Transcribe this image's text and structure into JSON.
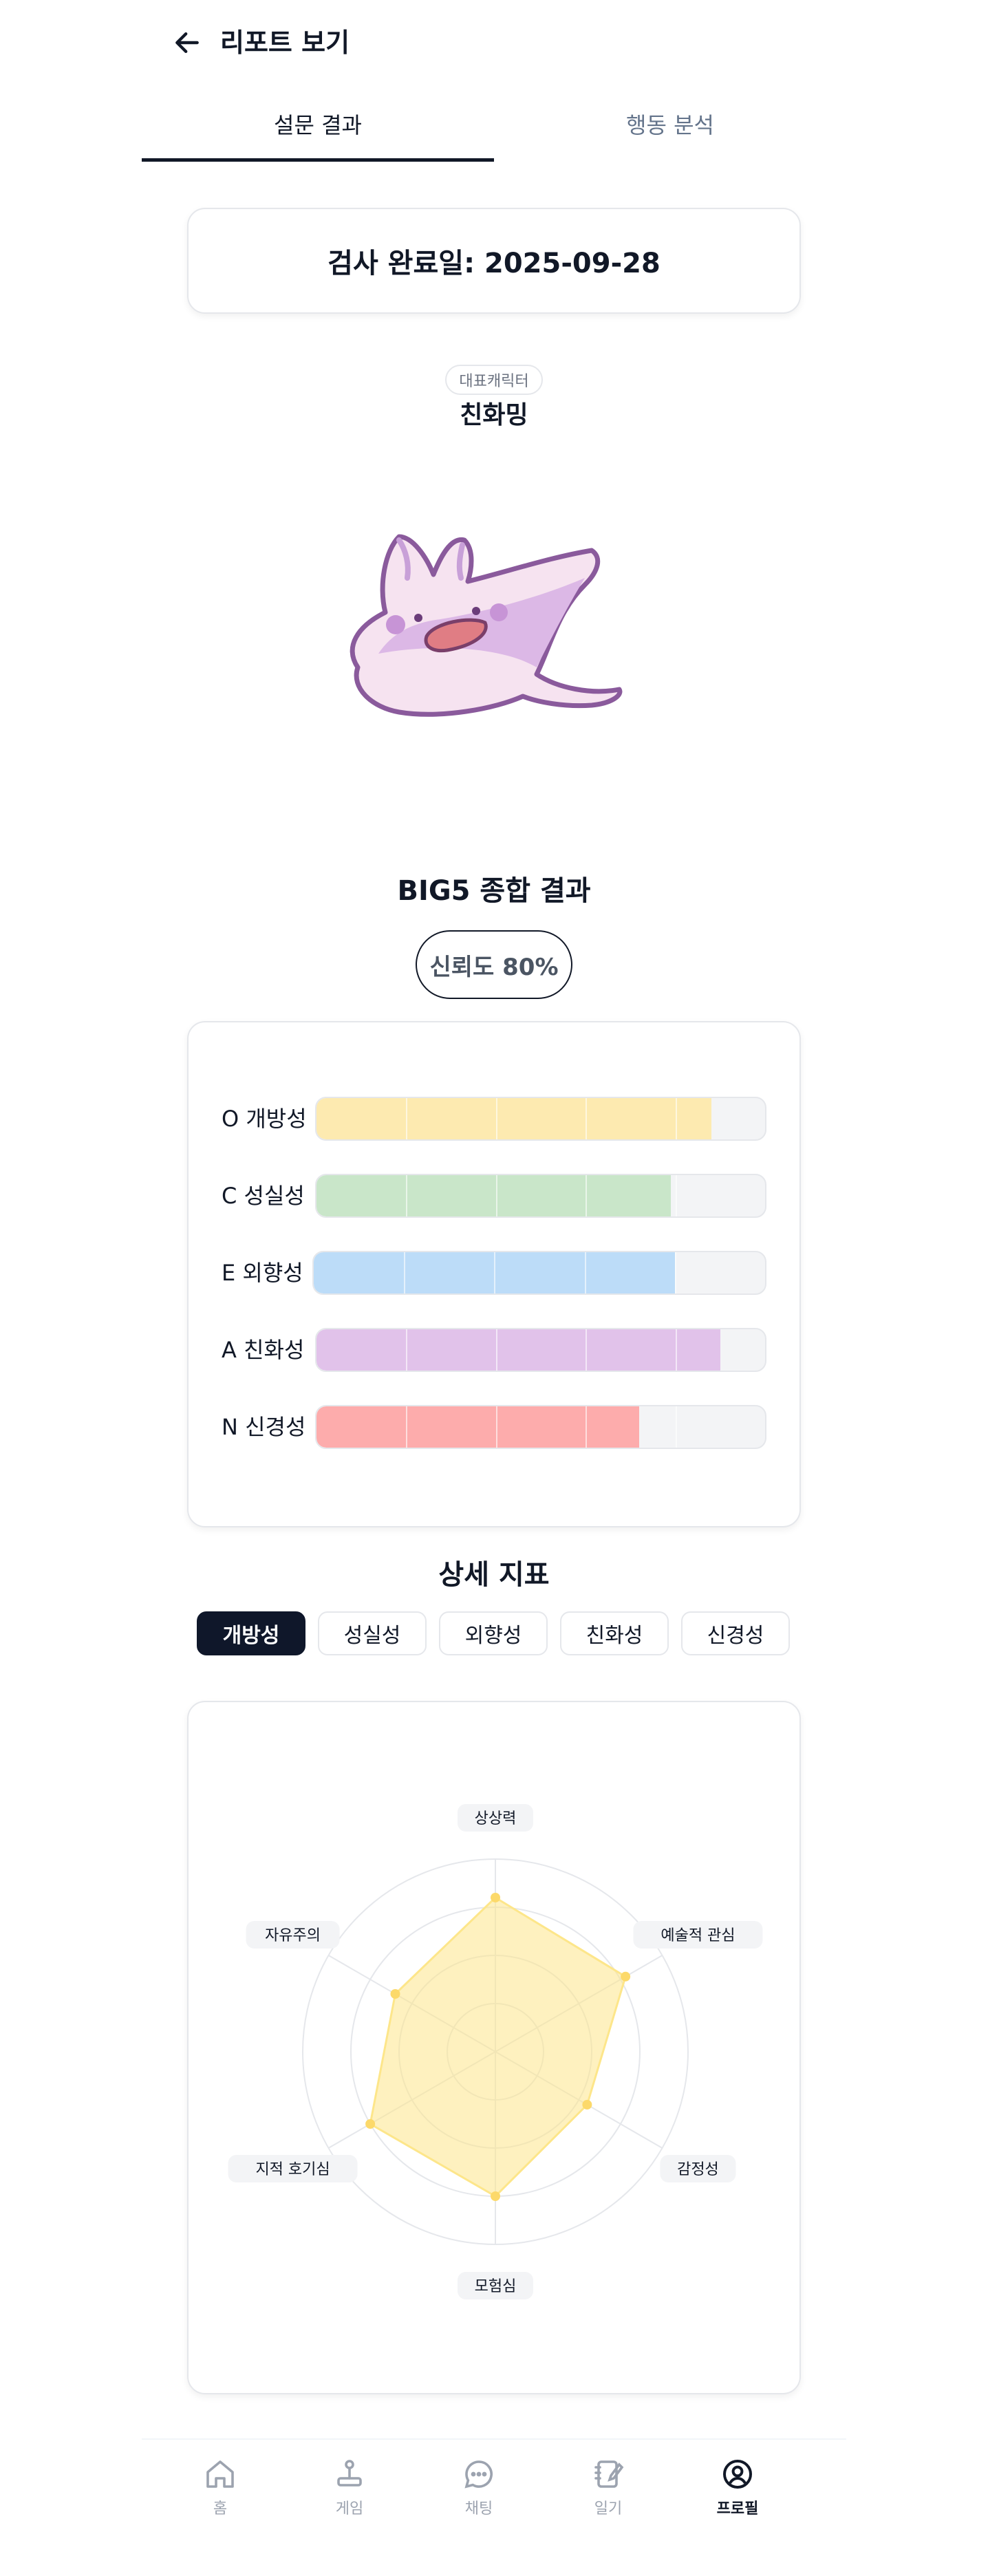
{
  "header": {
    "title": "리포트 보기",
    "back_icon": "arrow-left-icon"
  },
  "tabs": [
    {
      "label": "설문 결과",
      "active": true
    },
    {
      "label": "행동 분석",
      "active": false
    }
  ],
  "date_card": {
    "text": "검사 완료일: 2025-09-28"
  },
  "character": {
    "badge": "대표캐릭터",
    "name": "친화밍"
  },
  "big5": {
    "title": "BIG5 종합 결과",
    "reliability": "신뢰도 80%",
    "traits": [
      {
        "label": "O 개방성",
        "value": 88,
        "color": "#fdeab0"
      },
      {
        "label": "C 성실성",
        "value": 79,
        "color": "#c9e6c9"
      },
      {
        "label": "E 외향성",
        "value": 80,
        "color": "#bcdcf8"
      },
      {
        "label": "A 친화성",
        "value": 90,
        "color": "#e1c2ea"
      },
      {
        "label": "N 신경성",
        "value": 72,
        "color": "#fdacac"
      }
    ]
  },
  "detail": {
    "title": "상세 지표",
    "chips": [
      {
        "label": "개방성",
        "active": true
      },
      {
        "label": "성실성",
        "active": false
      },
      {
        "label": "외향성",
        "active": false
      },
      {
        "label": "친화성",
        "active": false
      },
      {
        "label": "신경성",
        "active": false
      }
    ]
  },
  "chart_data": {
    "type": "radar",
    "axes": [
      "상상력",
      "예술적 관심",
      "감정성",
      "모험심",
      "지적 호기심",
      "자유주의"
    ],
    "series": [
      {
        "values": [
          80,
          78,
          55,
          75,
          75,
          60
        ]
      }
    ],
    "range": [
      0,
      100
    ],
    "color": "#fde68a",
    "grid": true
  },
  "bottom_nav": [
    {
      "label": "홈",
      "icon": "home-icon",
      "active": false
    },
    {
      "label": "게임",
      "icon": "joystick-icon",
      "active": false
    },
    {
      "label": "채팅",
      "icon": "chat-icon",
      "active": false
    },
    {
      "label": "일기",
      "icon": "notebook-icon",
      "active": false
    },
    {
      "label": "프로필",
      "icon": "profile-icon",
      "active": true
    }
  ]
}
